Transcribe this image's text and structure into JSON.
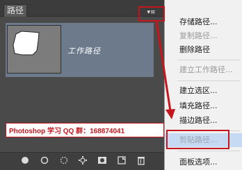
{
  "panel": {
    "tab_label": "路径",
    "menu_button_glyph": "▾≡",
    "paths": [
      {
        "name": "工作路径",
        "selected": true
      }
    ]
  },
  "context_menu": {
    "items": [
      {
        "label": "存储路径...",
        "enabled": true
      },
      {
        "label": "复制路径...",
        "enabled": false
      },
      {
        "label": "删除路径",
        "enabled": true
      },
      {
        "label": "建立工作路径...",
        "enabled": false
      },
      {
        "label": "建立选区...",
        "enabled": true
      },
      {
        "label": "填充路径...",
        "enabled": true
      },
      {
        "label": "描边路径...",
        "enabled": true
      },
      {
        "label": "剪贴路径...",
        "enabled": false,
        "highlighted": true
      },
      {
        "label": "面板选项...",
        "enabled": true
      }
    ]
  },
  "bottom_toolbar": {
    "icons": [
      "fill-path-icon",
      "stroke-path-icon",
      "load-selection-icon",
      "make-work-path-icon",
      "add-mask-icon",
      "new-path-icon",
      "delete-path-icon"
    ]
  },
  "annotation": {
    "caption": "Photoshop 学习 QQ 群：168874041",
    "accent_color": "#c4161c"
  }
}
